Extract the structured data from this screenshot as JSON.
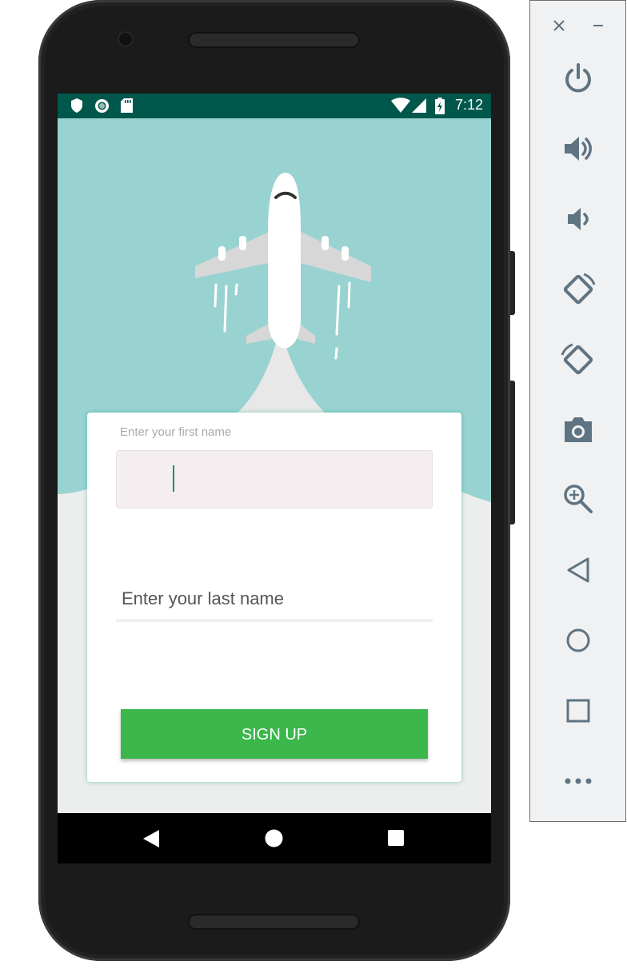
{
  "status_bar": {
    "time": "7:12",
    "background_color": "#00574b",
    "left_icons": [
      "shield-icon",
      "record-icon",
      "sd-card-icon"
    ],
    "right_icons": [
      "wifi-icon",
      "cell-signal-icon",
      "battery-charging-icon"
    ]
  },
  "form": {
    "first_name_label": "Enter your first name",
    "first_name_value": "",
    "last_name_placeholder": "Enter your last name",
    "last_name_value": "",
    "signup_label": "SIGN UP",
    "accent_color": "#3bb74b",
    "hero_color": "#99d3d1"
  },
  "nav_bar": {
    "buttons": [
      "back-icon",
      "home-icon",
      "recents-icon"
    ]
  },
  "emulator_toolbar": {
    "window_controls": [
      "close-icon",
      "minimize-icon"
    ],
    "items": [
      "power-icon",
      "volume-up-icon",
      "volume-down-icon",
      "rotate-left-icon",
      "rotate-right-icon",
      "camera-icon",
      "zoom-icon",
      "back-icon",
      "home-icon",
      "overview-icon",
      "more-icon"
    ]
  }
}
